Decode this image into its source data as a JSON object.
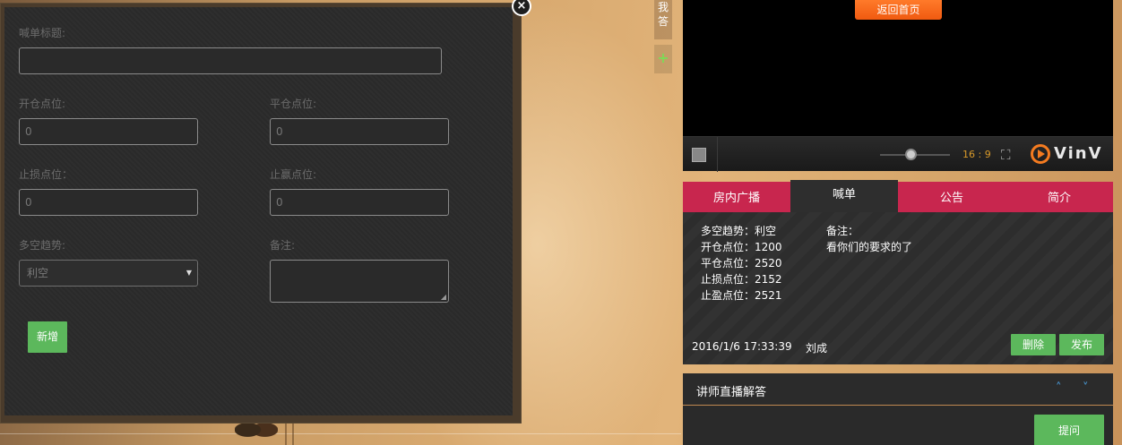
{
  "modal": {
    "close_symbol": "×",
    "title_label": "喊单标题:",
    "title_value": "",
    "open_label": "开仓点位:",
    "open_placeholder": "0",
    "close_label": "平仓点位:",
    "close_placeholder": "0",
    "stoploss_label": "止损点位：",
    "stoploss_placeholder": "0",
    "takeprofit_label": "止赢点位:",
    "takeprofit_placeholder": "0",
    "trend_label": "多空趋势:",
    "trend_value": "利空",
    "note_label": "备注:",
    "add_button": "新增"
  },
  "side_strip": {
    "tab_label": "我答",
    "plus_symbol": "+"
  },
  "video": {
    "home_button": "返回首页",
    "ratio": "16 : 9",
    "logo_text": "VinV",
    "volume_level": 0.45
  },
  "tabs": [
    {
      "label": "房内广播",
      "active": false
    },
    {
      "label": "喊单",
      "active": true
    },
    {
      "label": "公告",
      "active": false
    },
    {
      "label": "简介",
      "active": false
    }
  ],
  "call": {
    "lines": [
      "多空趋势：利空",
      "开仓点位：1200",
      "平仓点位：2520",
      "止损点位：2152",
      "止盈点位：2521"
    ],
    "note_title": "备注：",
    "note_text": "看你们的要求的了",
    "timestamp": "2016/1/6 17:33:39",
    "author": "刘成",
    "delete_button": "删除",
    "publish_button": "发布"
  },
  "qa": {
    "title": "讲师直播解答",
    "up_icon": "˄",
    "down_icon": "˅",
    "ask_button": "提问"
  },
  "colors": {
    "accent_red": "#c8264e",
    "button_green": "#5cb85c",
    "home_orange": "#f05a10"
  }
}
